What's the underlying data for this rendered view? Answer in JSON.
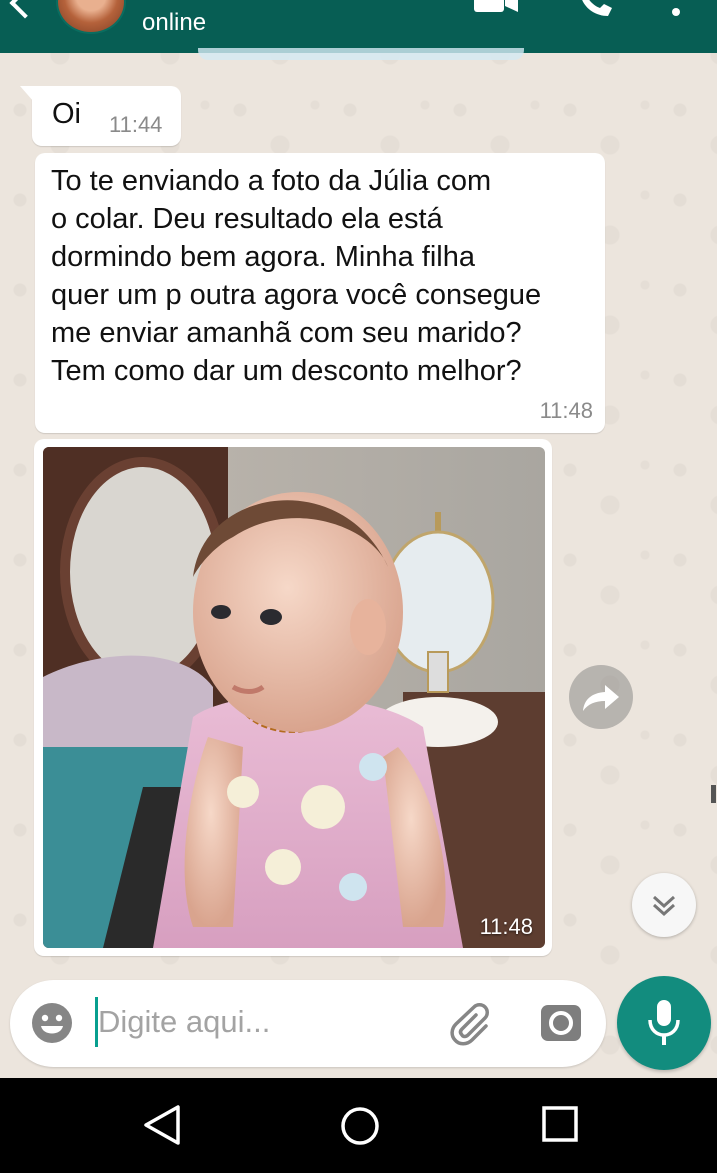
{
  "header": {
    "status": "online",
    "background_color": "#075e54"
  },
  "messages": [
    {
      "text": "Oi",
      "time": "11:44"
    },
    {
      "text": "To te enviando a foto da Júlia com\no colar.  Deu resultado ela está\ndormindo bem agora. Minha filha\nquer um p outra agora você consegue\nme enviar amanhã com seu marido?\nTem como dar um desconto melhor?",
      "time": "11:48"
    },
    {
      "type": "image",
      "time": "11:48"
    }
  ],
  "composer": {
    "placeholder": "Digite aqui..."
  },
  "colors": {
    "accent": "#128c7e",
    "header": "#075e54",
    "bubble": "#ffffff",
    "wallpaper": "#ece5dd"
  }
}
